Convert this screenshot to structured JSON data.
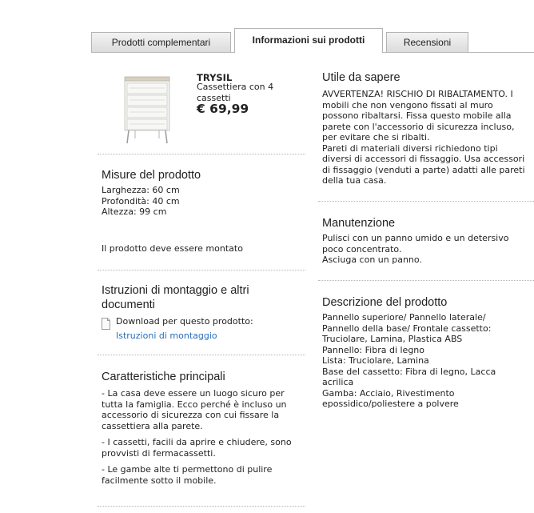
{
  "tabs": {
    "complementary": "Prodotti complementari",
    "info": "Informazioni sui prodotti",
    "reviews": "Recensioni"
  },
  "product": {
    "name": "TRYSIL",
    "description": "Cassettiera con 4 cassetti",
    "price": "€ 69,99"
  },
  "measures": {
    "title": "Misure del prodotto",
    "lines": [
      "Larghezza: 60 cm",
      "Profondità: 40 cm",
      "Altezza: 99 cm"
    ],
    "assembly_note": "Il prodotto deve essere montato"
  },
  "instructions": {
    "title": "Istruzioni di montaggio e altri documenti",
    "download_label": "Download per questo prodotto:",
    "link_text": "Istruzioni di montaggio"
  },
  "features": {
    "title": "Caratteristiche principali",
    "items": [
      "- La casa deve essere un luogo sicuro per tutta la famiglia. Ecco perché è incluso un accessorio di sicurezza con cui fissare la cassettiera alla parete.",
      "- I cassetti, facili da aprire e chiudere, sono provvisti di fermacassetti.",
      "- Le gambe alte ti permettono di pulire facilmente sotto il mobile."
    ]
  },
  "good_to_know": {
    "title": "Utile da sapere",
    "lines": [
      "AVVERTENZA! RISCHIO DI RIBALTAMENTO. I mobili che non vengono fissati al muro possono ribaltarsi. Fissa questo mobile alla parete con l'accessorio di sicurezza incluso, per evitare che si ribalti.",
      "Pareti di materiali diversi richiedono tipi diversi di accessori di fissaggio. Usa accessori di fissaggio (venduti a parte) adatti alle pareti della tua casa."
    ]
  },
  "care": {
    "title": "Manutenzione",
    "lines": [
      "Pulisci con un panno umido e un detersivo poco concentrato.",
      "Asciuga con un panno."
    ]
  },
  "product_description": {
    "title": "Descrizione del prodotto",
    "lines": [
      "Pannello superiore/ Pannello laterale/ Pannello della base/ Frontale cassetto: Truciolare, Lamina, Plastica ABS",
      "Pannello: Fibra di legno",
      "Lista: Truciolare, Lamina",
      "Base del cassetto: Fibra di legno, Lacca acrilica",
      "Gamba: Acciaio, Rivestimento epossidico/poliestere a polvere"
    ]
  }
}
